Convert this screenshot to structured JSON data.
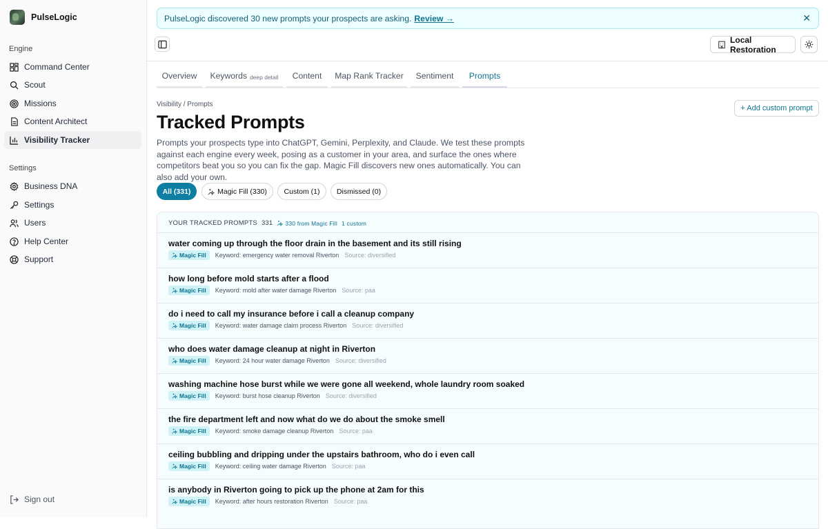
{
  "app": {
    "name": "PulseLogic"
  },
  "sidebar": {
    "engine_label": "Engine",
    "settings_label": "Settings",
    "engine_items": [
      {
        "label": "Command Center",
        "icon": "grid-icon"
      },
      {
        "label": "Scout",
        "icon": "search-icon"
      },
      {
        "label": "Missions",
        "icon": "target-icon"
      },
      {
        "label": "Content Architect",
        "icon": "document-icon"
      },
      {
        "label": "Visibility Tracker",
        "icon": "bar-chart-icon",
        "active": true
      }
    ],
    "settings_items": [
      {
        "label": "Business DNA",
        "icon": "gear-icon"
      },
      {
        "label": "Settings",
        "icon": "key-icon"
      },
      {
        "label": "Users",
        "icon": "users-icon"
      },
      {
        "label": "Help Center",
        "icon": "help-icon"
      },
      {
        "label": "Support",
        "icon": "lifebuoy-icon"
      }
    ],
    "signout": "Sign out"
  },
  "banner": {
    "text": "PulseLogic discovered 30 new prompts your prospects are asking.",
    "link": "Review →",
    "close": "✕"
  },
  "topbar": {
    "location": "Local Restoration"
  },
  "tabs": [
    {
      "label": "Overview",
      "sub": ""
    },
    {
      "label": "Keywords",
      "sub": "deep detail"
    },
    {
      "label": "Content",
      "sub": ""
    },
    {
      "label": "Map Rank Tracker",
      "sub": ""
    },
    {
      "label": "Sentiment",
      "sub": ""
    },
    {
      "label": "Prompts",
      "sub": "",
      "active": true
    }
  ],
  "page": {
    "breadcrumb": "Visibility / Prompts",
    "title": "Tracked Prompts",
    "description": "Prompts your prospects type into ChatGPT, Gemini, Perplexity, and Claude. We test these prompts against each engine every week, posing as a customer in your area, and surface the ones where competitors beat you so you can fix the gap. Magic Fill discovers new ones automatically. You can also add your own.",
    "add_button": "+ Add custom prompt"
  },
  "filters": [
    {
      "label": "All (331)",
      "active": true
    },
    {
      "label": "Magic Fill (330)",
      "icon": true
    },
    {
      "label": "Custom (1)"
    },
    {
      "label": "Dismissed (0)"
    }
  ],
  "list": {
    "heading": "YOUR TRACKED PROMPTS",
    "count": "331",
    "magic_fill_count": "330 from Magic Fill",
    "custom_count": "1 custom",
    "badge": "Magic Fill",
    "rows": [
      {
        "prompt": "water coming up through the floor drain in the basement and its still rising",
        "keyword": "Keyword: emergency water removal Riverton",
        "source": "Source: diversified"
      },
      {
        "prompt": "how long before mold starts after a flood",
        "keyword": "Keyword: mold after water damage Riverton",
        "source": "Source: paa"
      },
      {
        "prompt": "do i need to call my insurance before i call a cleanup company",
        "keyword": "Keyword: water damage claim process Riverton",
        "source": "Source: diversified"
      },
      {
        "prompt": "who does water damage cleanup at night in Riverton",
        "keyword": "Keyword: 24 hour water damage Riverton",
        "source": "Source: diversified"
      },
      {
        "prompt": "washing machine hose burst while we were gone all weekend, whole laundry room soaked",
        "keyword": "Keyword: burst hose cleanup Riverton",
        "source": "Source: diversified"
      },
      {
        "prompt": "the fire department left and now what do we do about the smoke smell",
        "keyword": "Keyword: smoke damage cleanup Riverton",
        "source": "Source: paa"
      },
      {
        "prompt": "ceiling bubbling and dripping under the upstairs bathroom, who do i even call",
        "keyword": "Keyword: ceiling water damage Riverton",
        "source": "Source: paa"
      },
      {
        "prompt": "is anybody in Riverton going to pick up the phone at 2am for this",
        "keyword": "Keyword: after hours restoration Riverton",
        "source": "Source: paa"
      }
    ]
  }
}
